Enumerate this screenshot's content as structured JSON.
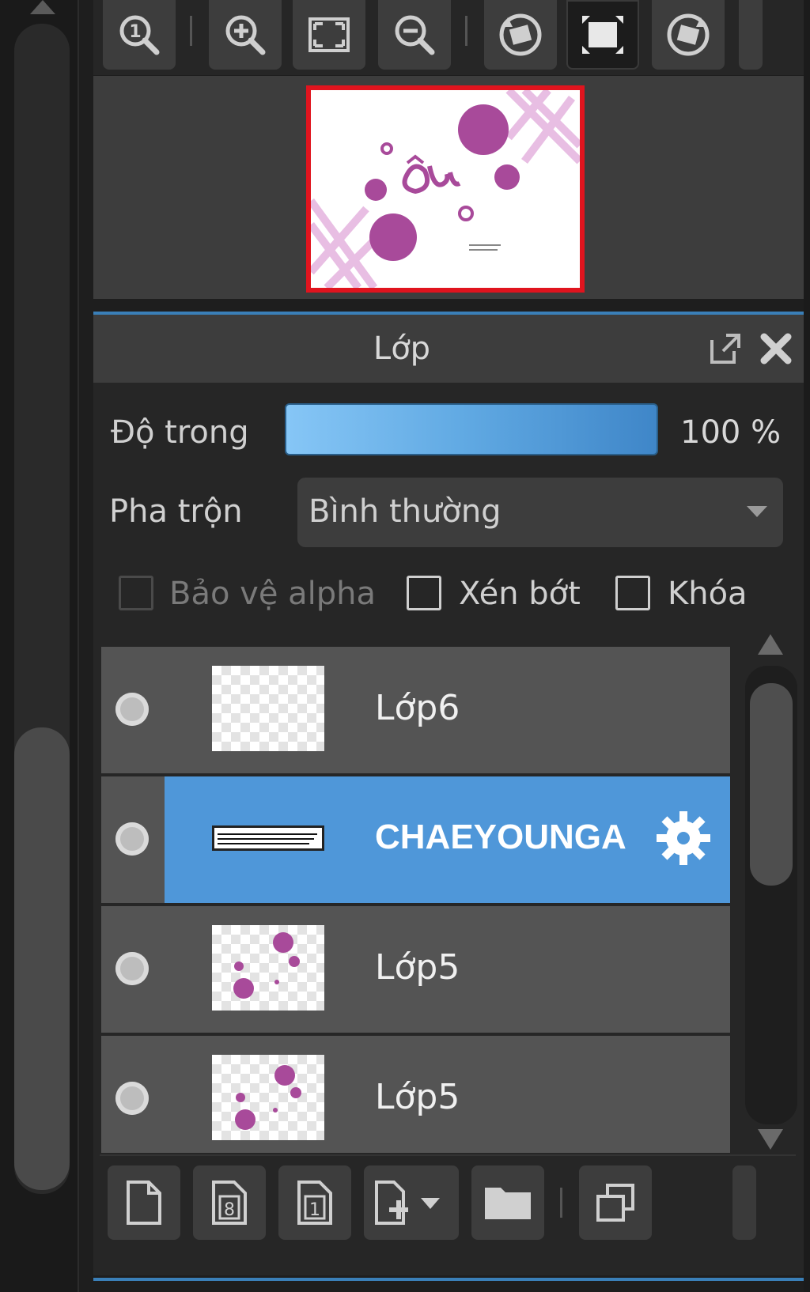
{
  "navigator": {
    "toolbar_icons": [
      "actual-size-icon",
      "zoom-in-icon",
      "fit-screen-icon",
      "zoom-out-icon",
      "rotate-left-icon",
      "fullscreen-icon",
      "rotate-right-icon"
    ],
    "preview_border_color": "#e0141e"
  },
  "panel": {
    "title": "Lớp",
    "opacity_label": "Độ trong",
    "opacity_value": "100 %",
    "opacity_fraction": 1.0,
    "blend_label": "Pha trộn",
    "blend_value": "Bình thường",
    "checkboxes": {
      "protect_alpha": "Bảo vệ alpha",
      "clipping": "Xén bớt",
      "lock": "Khóa"
    }
  },
  "layers": [
    {
      "name": "Lớp6",
      "selected": false
    },
    {
      "name": "CHAEYOUNGA",
      "selected": true
    },
    {
      "name": "Lớp5",
      "selected": false
    },
    {
      "name": "Lớp5",
      "selected": false
    }
  ],
  "bottom_toolbar": {
    "icons": [
      "new-layer-icon",
      "new-layer-8bit-icon",
      "new-layer-1bit-icon",
      "add-layer-dropdown-icon",
      "new-folder-icon",
      "duplicate-layer-icon"
    ]
  },
  "colors": {
    "accent_blue": "#4f97d9",
    "panel_bg": "#262626",
    "button_bg": "#3d3d3d",
    "preview_pink": "#a84a9a"
  }
}
